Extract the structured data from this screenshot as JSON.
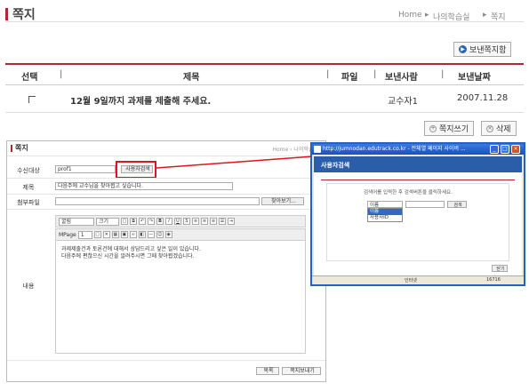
{
  "page": {
    "title": "쪽지",
    "breadcrumb": [
      "Home",
      "나의학습실",
      "쪽지"
    ]
  },
  "actions": {
    "sent_box": "보낸쪽지함",
    "write": "쪽지쓰기",
    "delete": "삭제"
  },
  "table": {
    "headers": [
      "선택",
      "제목",
      "파일",
      "보낸사람",
      "보낸날짜"
    ],
    "rows": [
      {
        "title": "12월 9일까지 과제를 제출해 주세요.",
        "sender": "교수자1",
        "date": "2007.11.28"
      }
    ]
  },
  "compose": {
    "title": "쪽지",
    "breadcrumb": "Home  ›  나의학습실",
    "recipient_label": "수신대상",
    "recipient_value": "prof1",
    "search_user_button": "사용자검색",
    "subject_label": "제목",
    "subject_value": "다음주에 교수님을 찾아뵙고 싶습니다.",
    "attach_label": "첨부파일",
    "browse_button": "찾아보기...",
    "content_label": "내용",
    "toolbar": {
      "font": "굴림",
      "size": "크기",
      "mpage_label": "MPage",
      "mpage_value": "1"
    },
    "body_lines": [
      "과제제출건과 토론건에 대해서 상담드리고 싶은 일이 있습니다.",
      "다음주에 편찮으신 시간을 알려주시면 그때 찾아뵙겠습니다."
    ],
    "list_button": "목록",
    "send_button": "쪽지보내기"
  },
  "popup": {
    "window_title": "http://jumnodan.edutrack.co.kr - 전체열 페이지 사이버 ...",
    "header": "사용자검색",
    "instruction": "검색어를 입력한 후 검색버튼을 클릭하세요.",
    "select_value": "이름",
    "options": [
      "이름",
      "사용자ID"
    ],
    "search_button": "검색",
    "close_button": "닫기",
    "status_left": "인터넷",
    "status_right": "16716"
  },
  "colors": {
    "accent": "#b0282f",
    "callout": "#e0141e",
    "window_blue": "#2560c8"
  }
}
